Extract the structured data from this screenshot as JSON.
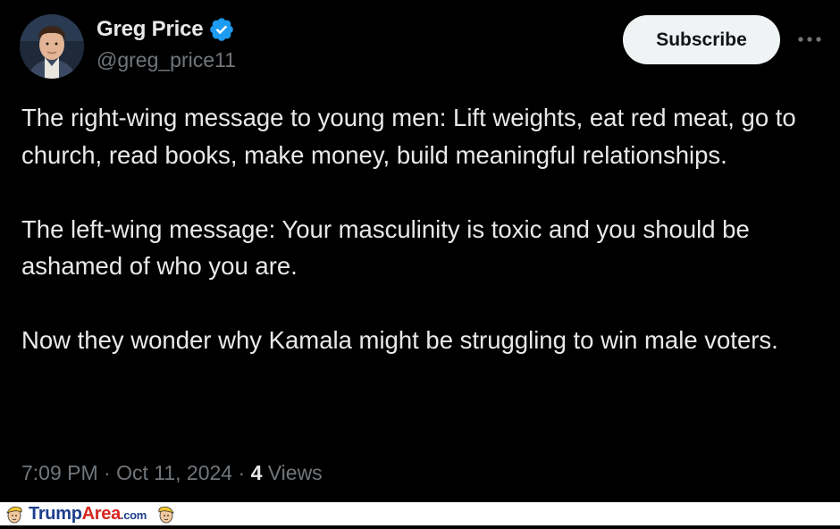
{
  "author": {
    "name": "Greg Price",
    "handle": "@greg_price11",
    "verified_color": "#1d9bf0"
  },
  "actions": {
    "subscribe_label": "Subscribe",
    "more_icon": "more-horizontal-icon"
  },
  "tweet": {
    "paragraphs": [
      "The right-wing message to young men: Lift weights, eat red meat, go to church, read books, make money, build meaningful relationships.",
      "The left-wing message: Your masculinity is toxic and you should be ashamed of who you are.",
      "Now they wonder why Kamala might be struggling to win male voters."
    ]
  },
  "meta": {
    "time": "7:09 PM",
    "separator": "·",
    "date": "Oct 11, 2024",
    "views_count": "4",
    "views_label": "Views"
  },
  "watermark": {
    "part1": "Trump",
    "part2": "Area",
    "part3": ".com"
  },
  "colors": {
    "background": "#000000",
    "text": "#e7e9ea",
    "secondary": "#71767b",
    "button_bg": "#eff3f4"
  }
}
